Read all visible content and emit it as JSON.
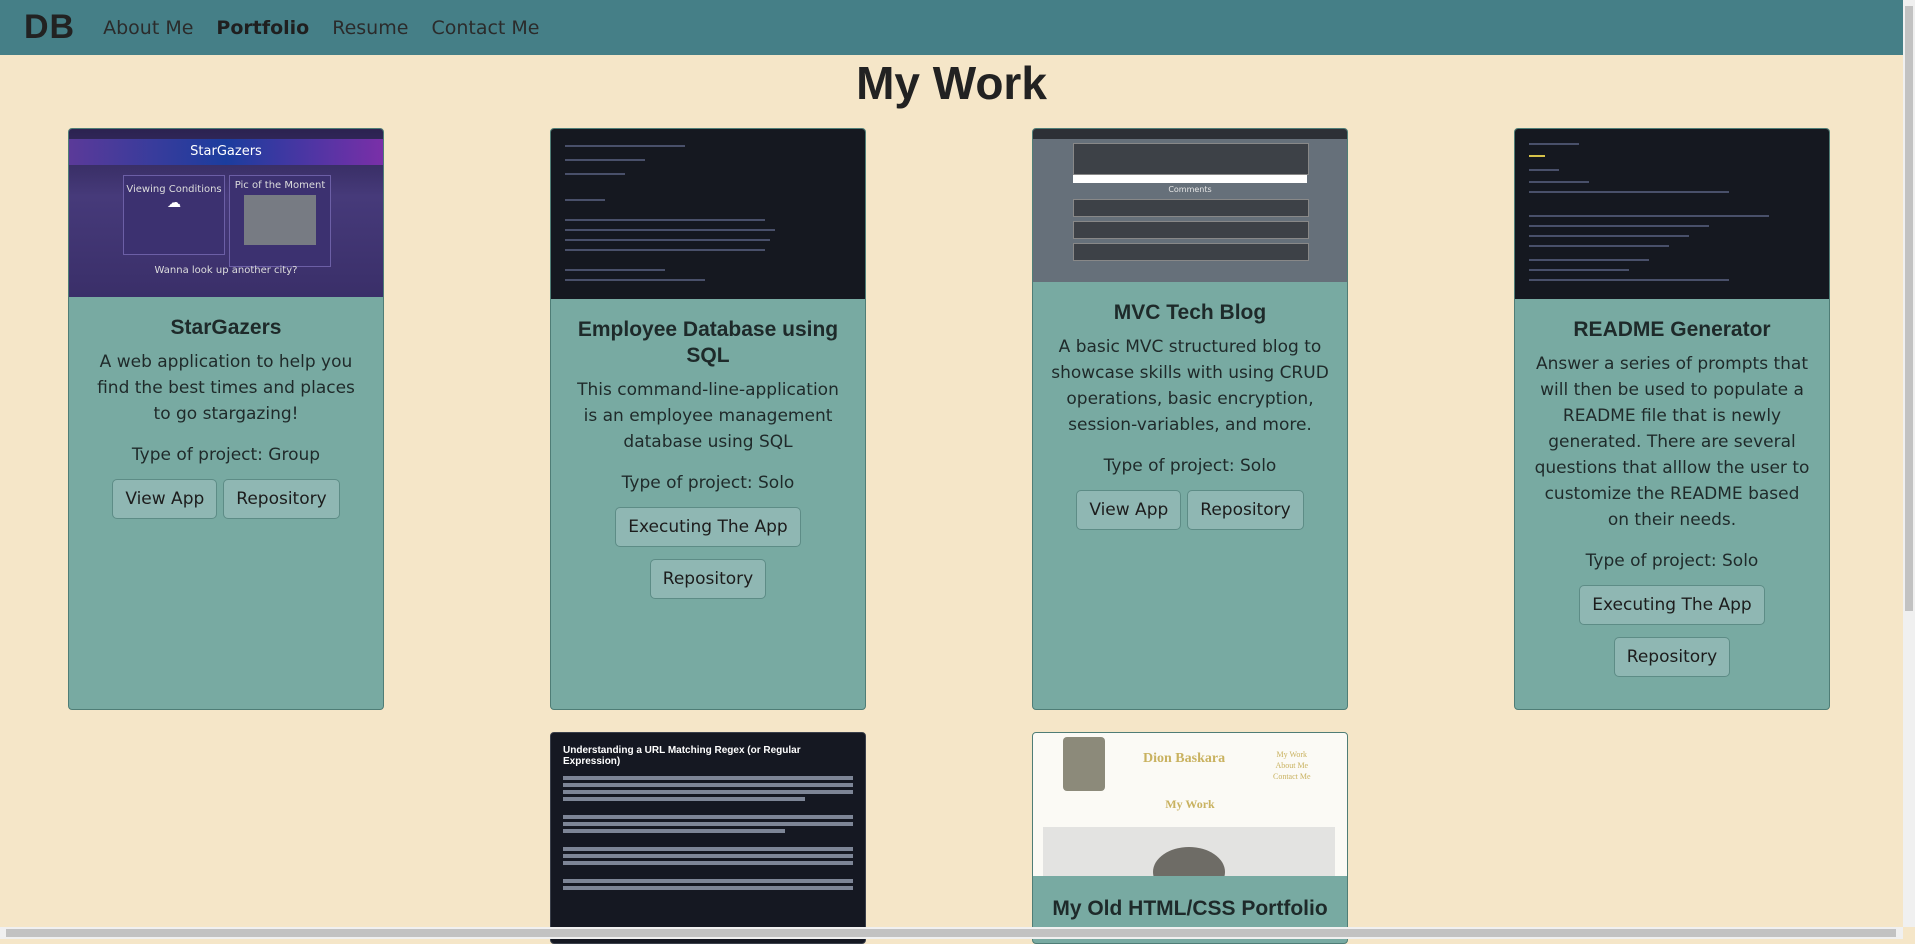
{
  "nav": {
    "brand": "DB",
    "links": [
      {
        "label": "About Me"
      },
      {
        "label": "Portfolio"
      },
      {
        "label": "Resume"
      },
      {
        "label": "Contact Me"
      }
    ]
  },
  "page": {
    "title": "My Work"
  },
  "cards": [
    {
      "title": "StarGazers",
      "description": "A web application to help you find the best times and places to go stargazing!",
      "type": "Type of project: Group",
      "buttons": [
        "View App",
        "Repository"
      ],
      "thumb_text": {
        "banner": "StarGazers",
        "left": "Viewing Conditions",
        "right": "Pic of the Moment",
        "bottom": "Wanna look up another city?"
      }
    },
    {
      "title": "Employee Database using SQL",
      "description": "This command-line-application is an employee management database using SQL",
      "type": "Type of project: Solo",
      "buttons": [
        "Executing The App",
        "Repository"
      ]
    },
    {
      "title": "MVC Tech Blog",
      "description": "A basic MVC structured blog to showcase skills with using CRUD operations, basic encryption, session-variables, and more.",
      "type": "Type of project: Solo",
      "buttons": [
        "View App",
        "Repository"
      ],
      "thumb_text": {
        "comments": "Comments"
      }
    },
    {
      "title": "README Generator",
      "description": "Answer a series of prompts that will then be used to populate a README file that is newly generated. There are several questions that alllow the user to customize the README based on their needs.",
      "type": "Type of project: Solo",
      "buttons": [
        "Executing The App",
        "Repository"
      ]
    },
    {
      "title": "Understanding a URL Matching Regex (or Regular Expression)",
      "thumb_only": true
    },
    {
      "title": "My Old HTML/CSS Portfolio",
      "thumb_text": {
        "name": "Dion Baskara",
        "heading": "My Work",
        "links": [
          "My Work",
          "About Me",
          "Contact Me"
        ]
      }
    }
  ],
  "colors": {
    "navbar": "#457f87",
    "background": "#f5e6c8",
    "card": "#78aaa2",
    "button": "#8fb7b3"
  }
}
